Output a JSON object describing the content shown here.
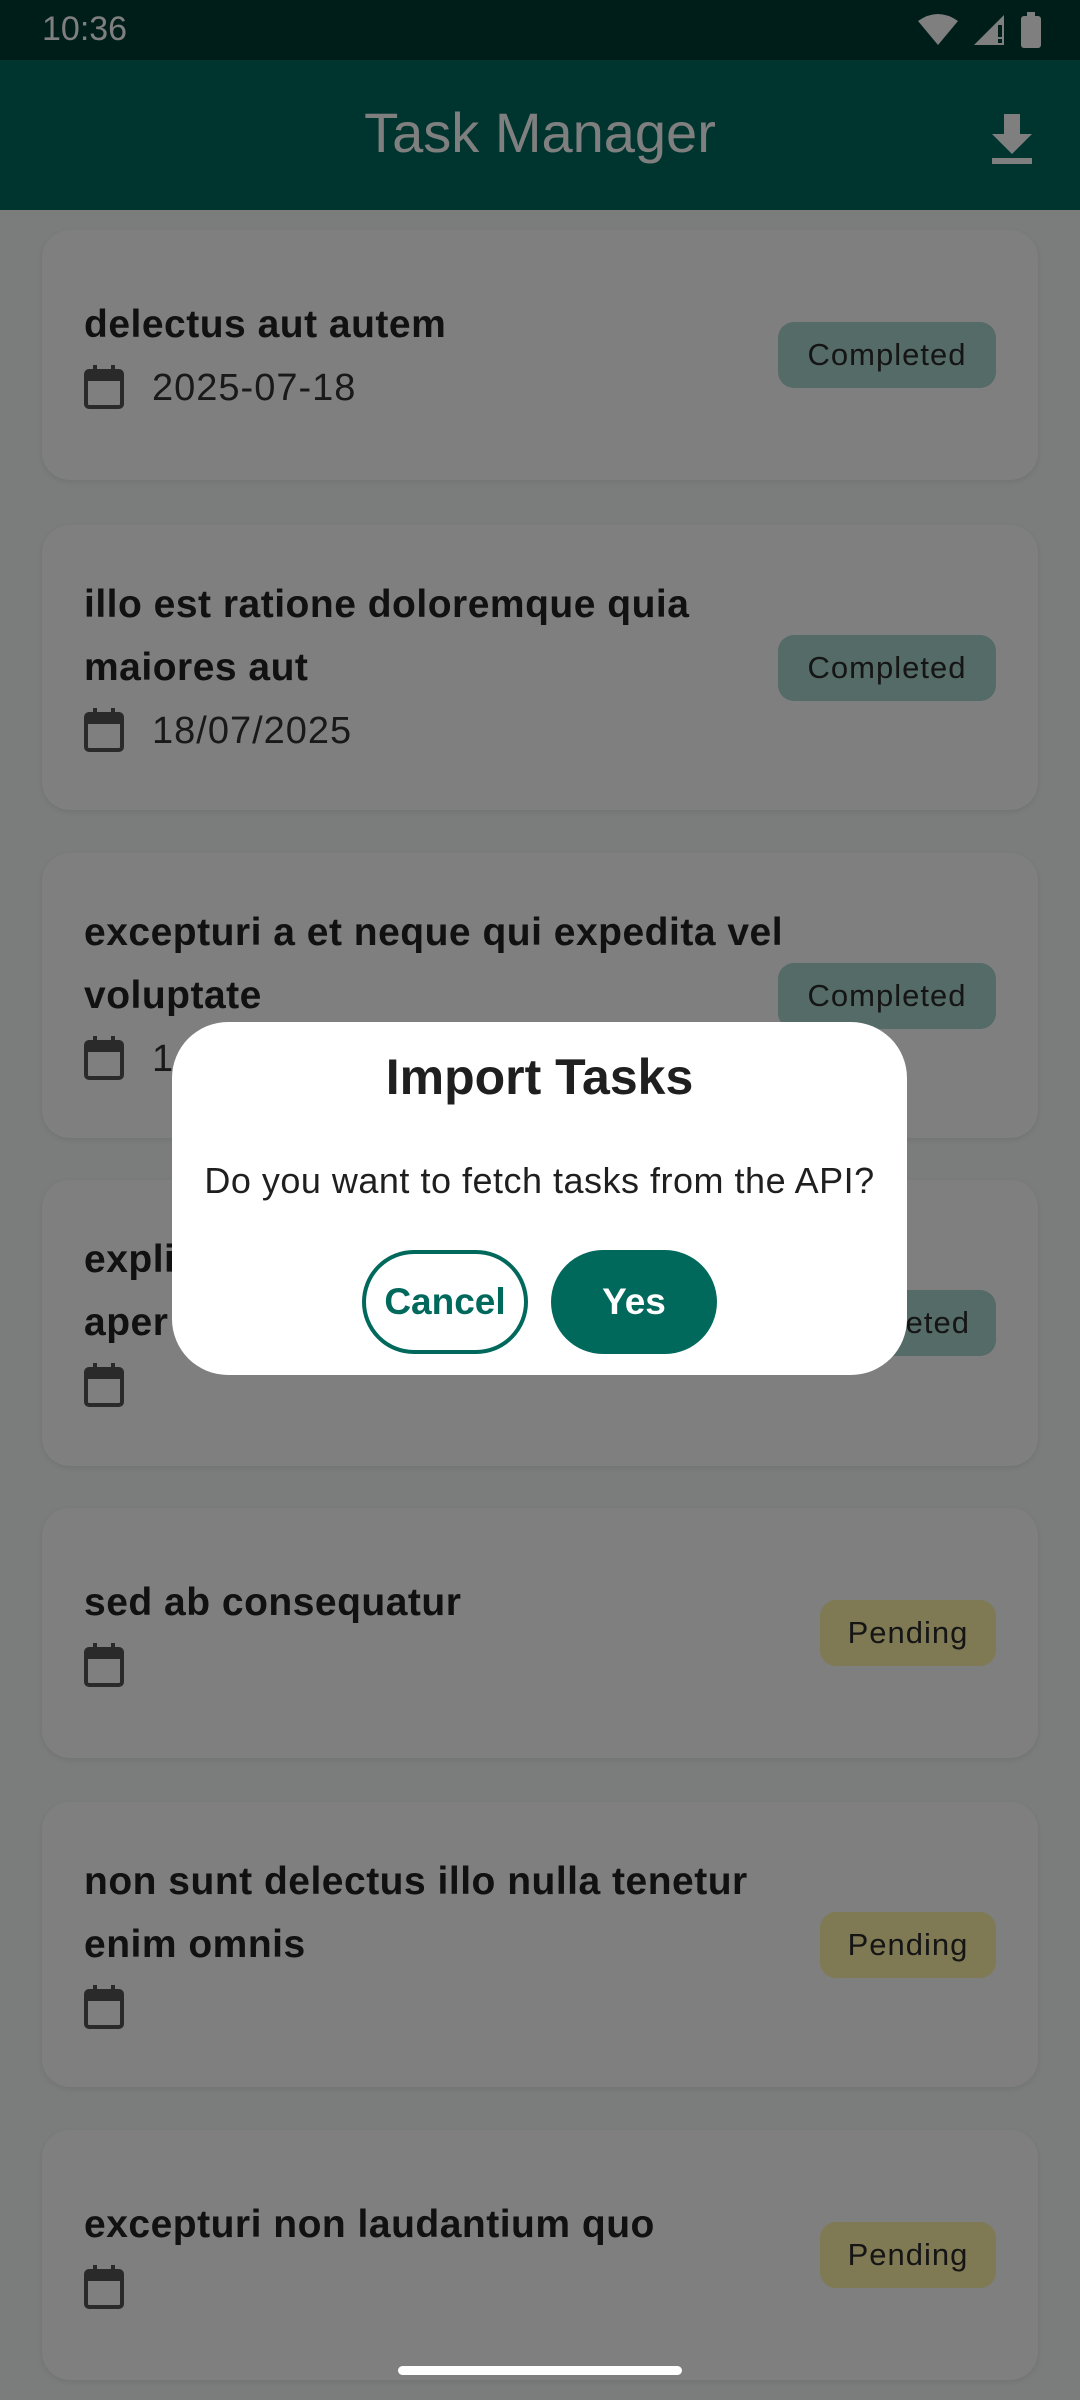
{
  "status_bar": {
    "time": "10:36",
    "icons": [
      "wifi-icon",
      "signal-icon",
      "battery-icon"
    ]
  },
  "app_bar": {
    "title": "Task Manager",
    "action_icon": "download-icon"
  },
  "tasks": [
    {
      "title": "delectus aut autem",
      "date": "2025-07-18",
      "status": "Completed"
    },
    {
      "title": "illo est ratione doloremque quia maiores aut",
      "date": "18/07/2025",
      "status": "Completed"
    },
    {
      "title": "excepturi a et neque qui expedita vel voluptate",
      "date": "1",
      "status": "Completed"
    },
    {
      "title": "expli aper",
      "date": "",
      "status": "eted"
    },
    {
      "title": "sed ab consequatur",
      "date": "",
      "status": "Pending"
    },
    {
      "title": "non sunt delectus illo nulla tenetur enim omnis",
      "date": "",
      "status": "Pending"
    },
    {
      "title": "excepturi non laudantium quo",
      "date": "",
      "status": "Pending"
    }
  ],
  "dialog": {
    "title": "Import Tasks",
    "message": "Do you want to fetch tasks from the API?",
    "cancel_label": "Cancel",
    "confirm_label": "Yes"
  },
  "colors": {
    "primary": "#00695c",
    "status_bar": "#003d33",
    "completed_badge": "#a8d6cf",
    "pending_badge": "#fff4a6"
  }
}
